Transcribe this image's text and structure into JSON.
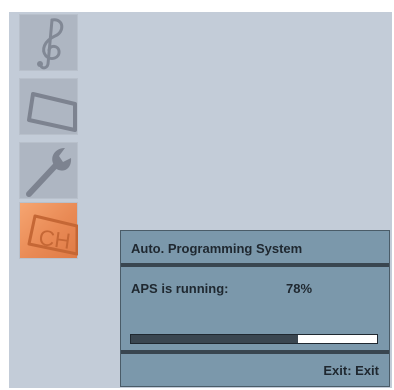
{
  "menu": {
    "items": [
      {
        "icon": "music-icon",
        "active": false
      },
      {
        "icon": "picture-icon",
        "active": false
      },
      {
        "icon": "wrench-icon",
        "active": false
      },
      {
        "icon": "channel-icon",
        "label": "CH",
        "active": true
      }
    ]
  },
  "dialog": {
    "title": "Auto. Programming System",
    "status_label": "APS is running:",
    "status_value": "78%",
    "progress_fraction": 0.68,
    "exit_hint": "Exit: Exit"
  },
  "colors": {
    "screen_bg": "#c3ccd8",
    "tile_bg": "#aeb6c2",
    "active_tile": "#e98a55",
    "dialog_bg": "#7b98ab",
    "separator": "#394650",
    "progress_fill": "#3a4650"
  }
}
